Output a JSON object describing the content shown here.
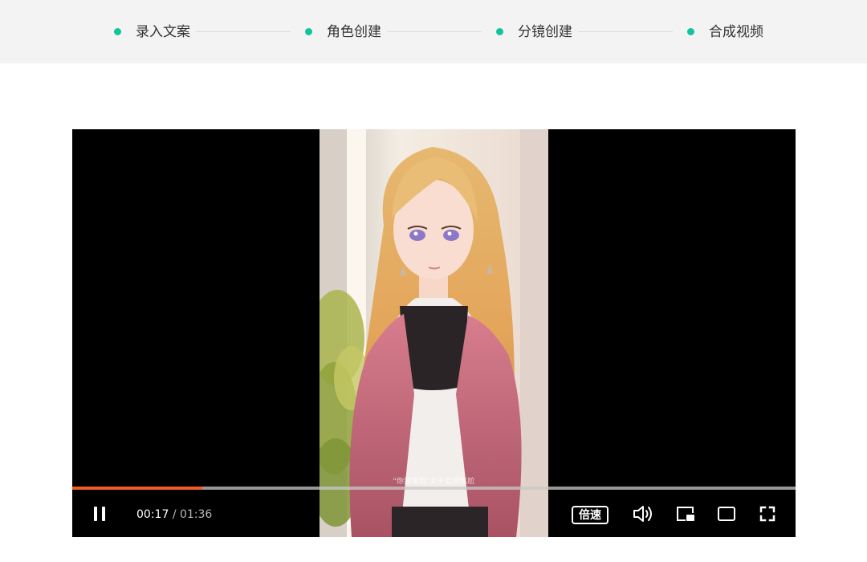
{
  "stepper": {
    "steps": [
      {
        "label": "录入文案"
      },
      {
        "label": "角色创建"
      },
      {
        "label": "分镜创建"
      },
      {
        "label": "合成视频"
      }
    ],
    "accent_color": "#12c49a"
  },
  "player": {
    "subtitle": "\"你要离婚\"女子显得尴尬",
    "current_time": "00:17",
    "separator": "/",
    "duration": "01:36",
    "progress_fraction": 0.18,
    "progress_color": "#f05d24",
    "speed_label": "倍速",
    "icons": [
      "pause-icon",
      "volume-icon",
      "picture-in-picture-icon",
      "widescreen-icon",
      "fullscreen-icon"
    ]
  }
}
